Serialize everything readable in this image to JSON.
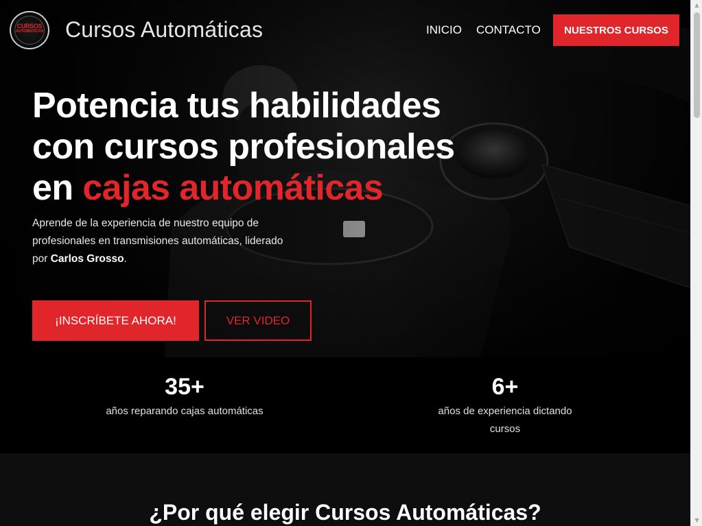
{
  "header": {
    "logo_lines": [
      "CURSOS",
      "AUTOMATICAS"
    ],
    "brand": "Cursos Automáticas",
    "nav": [
      {
        "label": "INICIO"
      },
      {
        "label": "CONTACTO"
      }
    ],
    "cta_label": "NUESTROS CURSOS"
  },
  "hero": {
    "title_line1": "Potencia tus habilidades",
    "title_line2": "con cursos profesionales",
    "title_line3_prefix": "en ",
    "title_line3_accent": "cajas automáticas",
    "subtitle_prefix": "Aprende de la experiencia de nuestro equipo de profesionales en transmisiones automáticas, liderado por ",
    "subtitle_bold": "Carlos Grosso",
    "subtitle_suffix": ".",
    "primary_button": "¡INSCRÍBETE AHORA!",
    "secondary_button": "VER VIDEO"
  },
  "stats": [
    {
      "number": "35+",
      "label": "años reparando cajas automáticas"
    },
    {
      "number": "6+",
      "label": "años de experiencia dictando cursos"
    }
  ],
  "why": {
    "title": "¿Por qué elegir Cursos Automáticas?"
  },
  "colors": {
    "accent": "#e0262b",
    "background": "#000000",
    "text": "#ffffff"
  },
  "icons": {
    "logo": "circular-badge-logo",
    "scroll_up": "triangle-up-icon",
    "scroll_down": "triangle-down-icon"
  }
}
